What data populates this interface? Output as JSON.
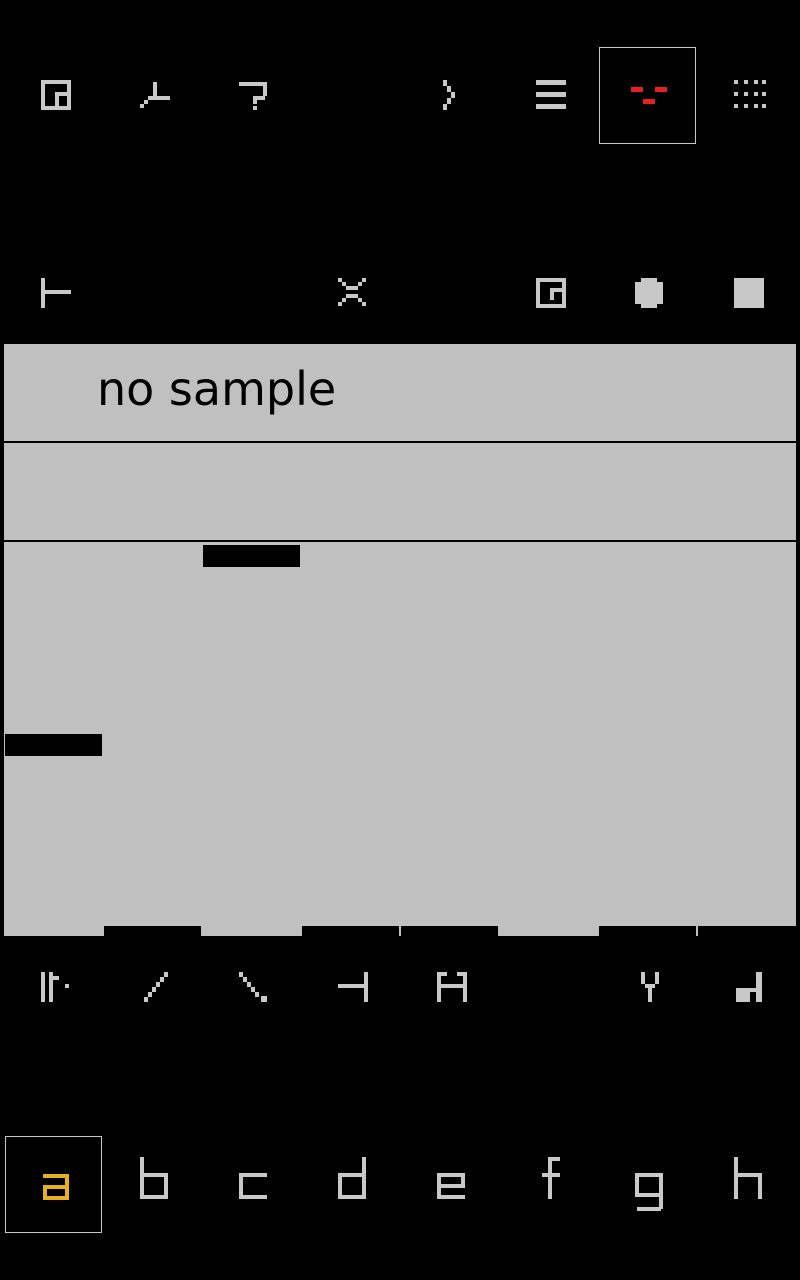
{
  "sample": {
    "label": "no sample"
  },
  "toolbar_top": [
    {
      "name": "window-icon"
    },
    {
      "name": "wave-icon"
    },
    {
      "name": "help-icon"
    },
    {
      "name": "empty"
    },
    {
      "name": "chevron-right-icon"
    },
    {
      "name": "menu-icon"
    },
    {
      "name": "face-icon",
      "selected": true
    },
    {
      "name": "grid-icon"
    }
  ],
  "toolbar_second": [
    {
      "name": "start-marker-icon"
    },
    {
      "name": "empty"
    },
    {
      "name": "empty"
    },
    {
      "name": "close-x-icon"
    },
    {
      "name": "empty"
    },
    {
      "name": "window-small-icon"
    },
    {
      "name": "circle-icon"
    },
    {
      "name": "square-icon"
    }
  ],
  "tools_row": [
    {
      "name": "bar-dot-icon"
    },
    {
      "name": "slash-up-icon"
    },
    {
      "name": "slash-down-icon"
    },
    {
      "name": "tee-left-icon"
    },
    {
      "name": "h-icon"
    },
    {
      "name": "empty"
    },
    {
      "name": "fork-icon"
    },
    {
      "name": "corner-icon"
    }
  ],
  "channels": [
    {
      "label": "a",
      "selected": true
    },
    {
      "label": "b"
    },
    {
      "label": "c"
    },
    {
      "label": "d"
    },
    {
      "label": "e"
    },
    {
      "label": "f"
    },
    {
      "label": "g"
    },
    {
      "label": "h"
    }
  ],
  "colors": {
    "accent": "#e8b020",
    "face": "#e82020",
    "icon": "#c8c8c8",
    "panel": "#c0c0c0"
  }
}
